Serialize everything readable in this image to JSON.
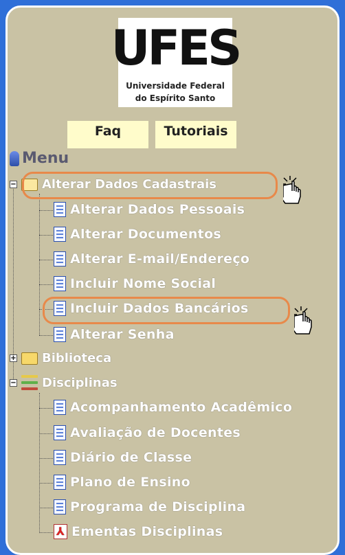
{
  "logo": {
    "mark": "UFES",
    "line1": "Universidade Federal",
    "line2": "do Espírito Santo"
  },
  "quick_links": {
    "faq": "Faq",
    "tutoriais": "Tutoriais"
  },
  "menu": {
    "title": "Menu",
    "groups": [
      {
        "label": "Alterar Dados Cadastrais",
        "expanded": true,
        "items": [
          {
            "label": "Alterar Dados Pessoais",
            "icon": "document-icon"
          },
          {
            "label": "Alterar Documentos",
            "icon": "document-icon"
          },
          {
            "label": "Alterar E-mail/Endereço",
            "icon": "document-icon"
          },
          {
            "label": "Incluir Nome Social",
            "icon": "document-icon"
          },
          {
            "label": "Incluir Dados Bancários",
            "icon": "document-icon"
          },
          {
            "label": "Alterar Senha",
            "icon": "document-icon"
          }
        ]
      },
      {
        "label": "Biblioteca",
        "expanded": false,
        "items": []
      },
      {
        "label": "Disciplinas",
        "expanded": true,
        "items": [
          {
            "label": "Acompanhamento Acadêmico",
            "icon": "document-icon"
          },
          {
            "label": "Avaliação de Docentes",
            "icon": "document-icon"
          },
          {
            "label": "Diário de Classe",
            "icon": "document-icon"
          },
          {
            "label": "Plano de Ensino",
            "icon": "document-icon"
          },
          {
            "label": "Programa de Disciplina",
            "icon": "document-icon"
          },
          {
            "label": "Ementas Disciplinas",
            "icon": "pdf-icon"
          }
        ]
      }
    ]
  },
  "expander_symbols": {
    "collapse": "−",
    "expand": "+"
  },
  "colors": {
    "background": "#2f6fd8",
    "panel": "#c9c2a4",
    "highlight": "#e8894a",
    "quick_link_bg": "#fffccb"
  }
}
